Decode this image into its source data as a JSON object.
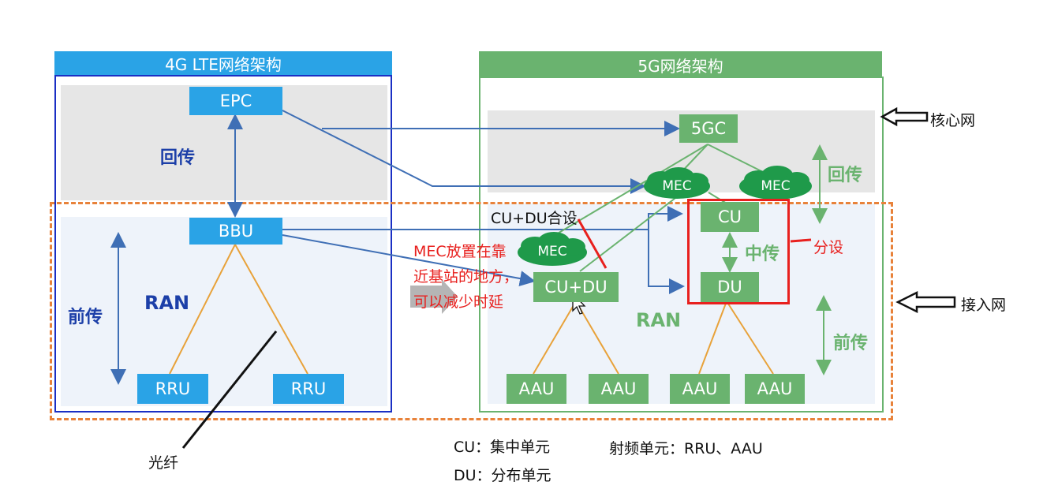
{
  "panels": {
    "lte": {
      "title": "4G LTE网络架构"
    },
    "nr": {
      "title": "5G网络架构"
    }
  },
  "lte": {
    "epc": "EPC",
    "bbu": "BBU",
    "rru_left": "RRU",
    "rru_right": "RRU",
    "backhaul": "回传",
    "fronthaul": "前传",
    "ran": "RAN"
  },
  "nr": {
    "core": "5GC",
    "mec_1": "MEC",
    "mec_2": "MEC",
    "mec_3": "MEC",
    "cu": "CU",
    "du": "DU",
    "cudu": "CU+DU",
    "aau_1": "AAU",
    "aau_2": "AAU",
    "aau_3": "AAU",
    "aau_4": "AAU",
    "backhaul": "回传",
    "midhaul": "中传",
    "fronthaul": "前传",
    "ran": "RAN"
  },
  "annotations": {
    "core_network": "核心网",
    "access_network": "接入网",
    "cu_du_colocated": "CU+DU合设",
    "separate": "分设",
    "mec_note_1": "MEC放置在靠",
    "mec_note_2": "近基站的地方，",
    "mec_note_3": "可以减少时延",
    "fiber": "光纤",
    "cu_def": "CU：集中单元",
    "du_def": "DU：分布单元",
    "rf_def": "射频单元：RRU、AAU"
  },
  "colors": {
    "lte_blue": "#2aa3e6",
    "lte_border": "#1a2fc4",
    "nr_green": "#6ab36f",
    "dashed_orange": "#e8823a",
    "red": "#e8201e",
    "line_blue": "#3f6fb5",
    "tree_orange": "#e8a23a"
  }
}
